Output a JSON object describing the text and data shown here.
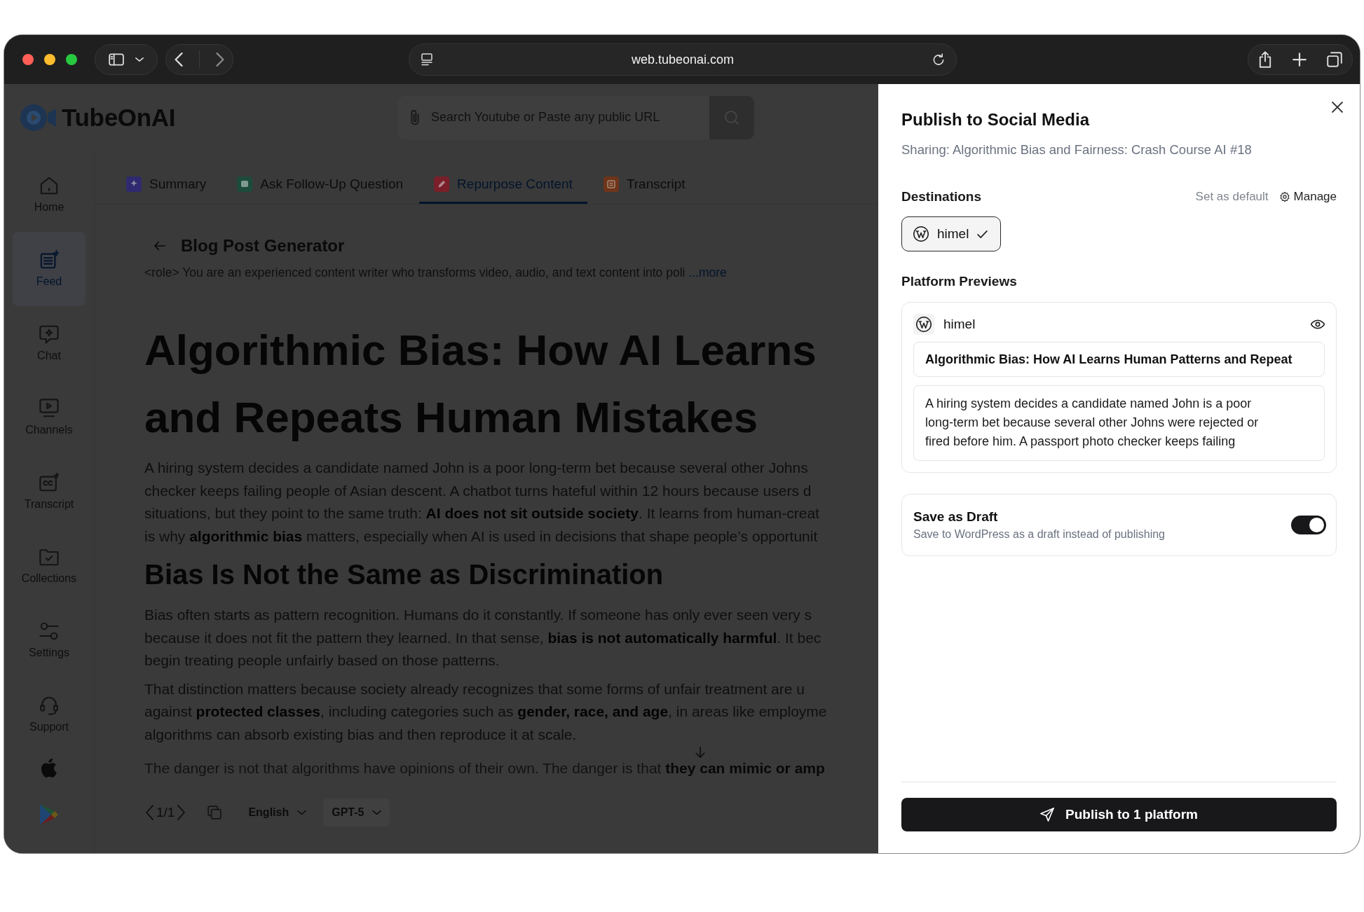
{
  "browser": {
    "url": "web.tubeonai.com"
  },
  "header": {
    "logo": "TubeOnAI",
    "search": {
      "placeholder": "Search Youtube or Paste any public URL"
    }
  },
  "sidebar": {
    "items": [
      {
        "label": "Home",
        "kind": "home",
        "selected": false
      },
      {
        "label": "Feed",
        "kind": "feed",
        "selected": true
      },
      {
        "label": "Chat",
        "kind": "chat",
        "selected": false
      },
      {
        "label": "Channels",
        "kind": "channels",
        "selected": false
      },
      {
        "label": "Transcript",
        "kind": "transcript",
        "selected": false
      },
      {
        "label": "Collections",
        "kind": "collections",
        "selected": false
      },
      {
        "label": "Settings",
        "kind": "settings",
        "selected": false
      },
      {
        "label": "Support",
        "kind": "support",
        "selected": false
      }
    ]
  },
  "tabs": [
    {
      "label": "Summary",
      "kind": "summary",
      "color": "#2f2a70",
      "selected": false
    },
    {
      "label": "Ask Follow-Up Question",
      "kind": "ask",
      "color": "#1d4b3b",
      "selected": false
    },
    {
      "label": "Repurpose Content",
      "kind": "repurpose",
      "color": "#7a1f2a",
      "selected": true
    },
    {
      "label": "Transcript",
      "kind": "transcript",
      "color": "#6e3419",
      "selected": false
    }
  ],
  "editor": {
    "title": "Blog Post Generator",
    "prompt": "<role> You are an experienced content writer who transforms video, audio, and text content into poli",
    "more": "...more",
    "article": [
      {
        "kind": "h1",
        "lines": [
          "Algorithmic Bias: How AI Learns",
          "and Repeats Human Mistakes"
        ]
      },
      {
        "kind": "p",
        "lines": [
          "A hiring system decides a candidate named John is a poor long-term bet because several other Johns",
          "checker keeps failing people of Asian descent. A chatbot turns hateful within 12 hours because users d",
          "situations, but they point to the same truth: **AI does not sit outside society**. It learns from human-creat",
          "is why **algorithmic bias** matters, especially when AI is used in decisions that shape people’s opportunit"
        ]
      },
      {
        "kind": "h2",
        "lines": [
          "Bias Is Not the Same as Discrimination"
        ]
      },
      {
        "kind": "p",
        "lines": [
          "Bias often starts as pattern recognition. Humans do it constantly. If someone has only ever seen very s",
          "because it does not fit the pattern they learned. In that sense, **bias is not automatically harmful**. It bec",
          "begin treating people unfairly based on those patterns."
        ]
      },
      {
        "kind": "p",
        "lines": [
          "That distinction matters because society already recognizes that some forms of unfair treatment are u",
          "against **protected classes**, including categories such as **gender, race, and age**, in areas like employme",
          "algorithms can absorb existing bias and then reproduce it at scale."
        ]
      },
      {
        "kind": "fade",
        "lines": [
          "The danger is not that algorithms have opinions of their own. The danger is that **they can mimic or amp**"
        ]
      }
    ],
    "toolbar": {
      "pager": "1/1",
      "language": "English",
      "model": "GPT-5"
    }
  },
  "publish_panel": {
    "title": "Publish to Social Media",
    "subtitle": "Sharing: Algorithmic Bias and Fairness: Crash Course AI #18",
    "destinations": {
      "label": "Destinations",
      "set_default": "Set as default",
      "manage": "Manage",
      "items": [
        {
          "name": "himel",
          "selected": true
        }
      ]
    },
    "previews": {
      "label": "Platform Previews",
      "items": [
        {
          "name": "himel",
          "title": "Algorithmic Bias: How AI Learns Human Patterns and Repeat",
          "body_lines": [
            "A hiring system decides a candidate named John is a poor",
            "long-term bet because several other Johns were rejected or",
            "fired before him. A passport photo checker keeps failing"
          ]
        }
      ]
    },
    "draft": {
      "title": "Save as Draft",
      "description": "Save to WordPress as a draft instead of publishing",
      "on": true
    },
    "publish_button": "Publish to 1 platform"
  }
}
